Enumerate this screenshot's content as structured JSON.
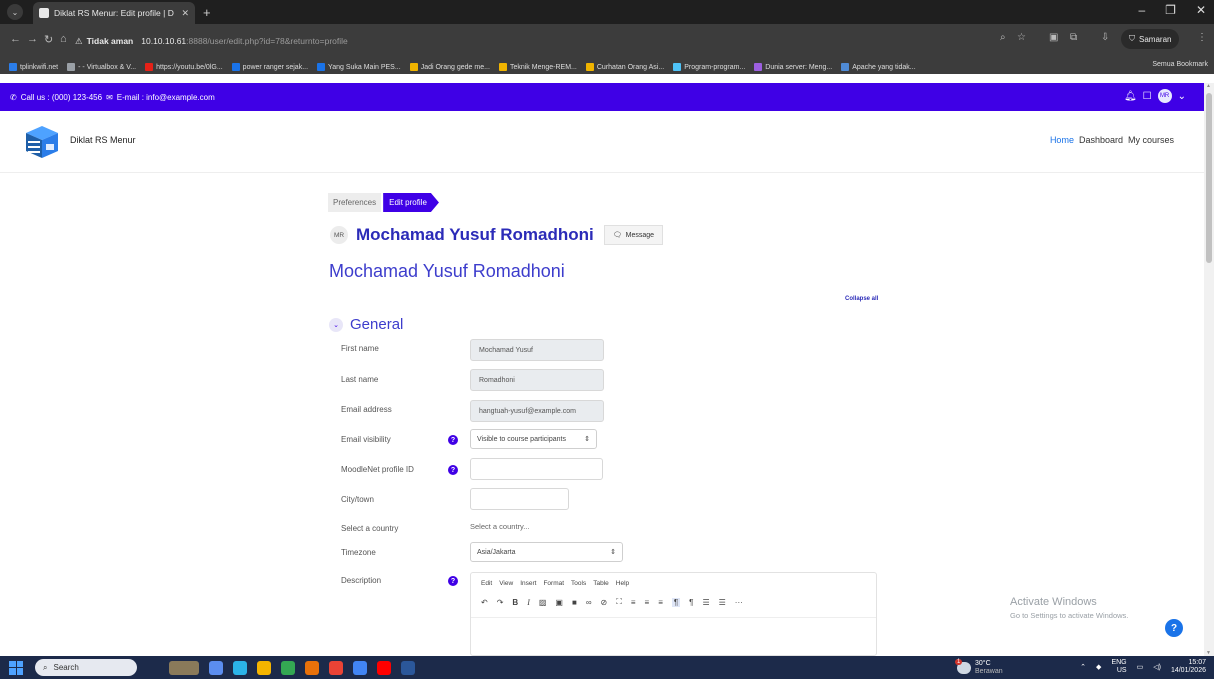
{
  "browser": {
    "tab_title": "Diklat RS Menur: Edit profile | D",
    "security_label": "Tidak aman",
    "url_host": "10.10.10.61",
    "url_rest": ":8888/user/edit.php?id=78&returnto=profile",
    "incognito_label": "Samaran",
    "bookmarks": [
      {
        "label": "tplinkwifi.net",
        "color": "#2b7de9"
      },
      {
        "label": "- - Virtualbox & V...",
        "color": "#9aa0a6"
      },
      {
        "label": "https://youtu.be/0lG...",
        "color": "#e62117"
      },
      {
        "label": "power ranger sejak...",
        "color": "#1a73e8"
      },
      {
        "label": "Yang Suka Main PES...",
        "color": "#1a73e8"
      },
      {
        "label": "Jadi Orang gede me...",
        "color": "#f0b400"
      },
      {
        "label": "Teknik Menge-REM...",
        "color": "#f0b400"
      },
      {
        "label": "Curhatan Orang Asi...",
        "color": "#f0b400"
      },
      {
        "label": "Program-program...",
        "color": "#4fc3f7"
      },
      {
        "label": "Dunia server: Meng...",
        "color": "#9c5fe0"
      },
      {
        "label": "Apache yang tidak...",
        "color": "#4f8bd6"
      }
    ],
    "bookmarks_all": "Semua Bookmark"
  },
  "topbar": {
    "contact": "Call us : (000) 123-456",
    "email": "E-mail : info@example.com",
    "avatar": "MR"
  },
  "header": {
    "site_name": "Diklat RS Menur",
    "nav": {
      "home": "Home",
      "dashboard": "Dashboard",
      "courses": "My courses"
    }
  },
  "breadcrumb": {
    "preferences": "Preferences",
    "edit_profile": "Edit profile"
  },
  "profile": {
    "initials": "MR",
    "name": "Mochamad Yusuf Romadhoni",
    "message": "Message",
    "page_heading": "Mochamad Yusuf Romadhoni",
    "collapse_all": "Collapse all"
  },
  "form": {
    "section": "General",
    "first_name_label": "First name",
    "first_name": "Mochamad Yusuf",
    "last_name_label": "Last name",
    "last_name": "Romadhoni",
    "email_label": "Email address",
    "email": "hangtuah-yusuf@example.com",
    "email_visibility_label": "Email visibility",
    "email_visibility": "Visible to course participants",
    "moodlenet_label": "MoodleNet profile ID",
    "city_label": "City/town",
    "country_label": "Select a country",
    "country": "Select a country...",
    "timezone_label": "Timezone",
    "timezone": "Asia/Jakarta",
    "description_label": "Description"
  },
  "editor": {
    "menus": [
      "Edit",
      "View",
      "Insert",
      "Format",
      "Tools",
      "Table",
      "Help"
    ]
  },
  "watermark": {
    "line1": "Activate Windows",
    "line2": "Go to Settings to activate Windows."
  },
  "taskbar": {
    "search": "Search",
    "temperature": "30°C",
    "weather": "Berawan",
    "weather_badge": "1",
    "lang": "ENG",
    "region": "US",
    "time": "15:07",
    "date": "14/01/2026"
  }
}
